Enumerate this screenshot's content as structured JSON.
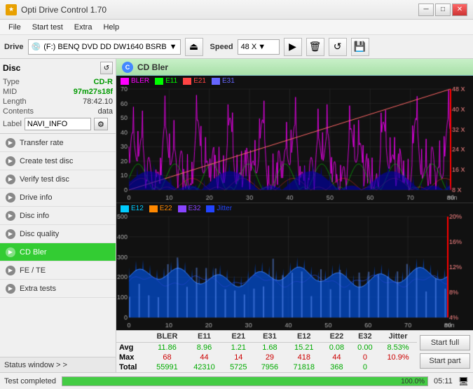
{
  "titlebar": {
    "title": "Opti Drive Control 1.70",
    "icon": "★",
    "minimize": "─",
    "maximize": "□",
    "close": "✕"
  },
  "menu": {
    "items": [
      "File",
      "Start test",
      "Extra",
      "Help"
    ]
  },
  "drive": {
    "label": "Drive",
    "drive_name": "(F:)  BENQ DVD DD DW1640 BSRB",
    "speed_label": "Speed",
    "speed_value": "48 X",
    "drive_icon": "💿"
  },
  "disc": {
    "title": "Disc",
    "type_key": "Type",
    "type_val": "CD-R",
    "mid_key": "MID",
    "mid_val": "97m27s18f",
    "length_key": "Length",
    "length_val": "78:42.10",
    "contents_key": "Contents",
    "contents_val": "data",
    "label_key": "Label",
    "label_val": "NAVI_INFO"
  },
  "nav": {
    "items": [
      {
        "id": "transfer-rate",
        "label": "Transfer rate",
        "active": false
      },
      {
        "id": "create-test-disc",
        "label": "Create test disc",
        "active": false
      },
      {
        "id": "verify-test-disc",
        "label": "Verify test disc",
        "active": false
      },
      {
        "id": "drive-info",
        "label": "Drive info",
        "active": false
      },
      {
        "id": "disc-info",
        "label": "Disc info",
        "active": false
      },
      {
        "id": "disc-quality",
        "label": "Disc quality",
        "active": false
      },
      {
        "id": "cd-bler",
        "label": "CD Bler",
        "active": true
      },
      {
        "id": "fe-te",
        "label": "FE / TE",
        "active": false
      },
      {
        "id": "extra-tests",
        "label": "Extra tests",
        "active": false
      }
    ],
    "status_window": "Status window > >"
  },
  "chart": {
    "title": "CD Bler",
    "icon": "C",
    "legend1": [
      {
        "label": "BLER",
        "color": "#ff00ff"
      },
      {
        "label": "E11",
        "color": "#00ff00"
      },
      {
        "label": "E21",
        "color": "#ff4444"
      },
      {
        "label": "E31",
        "color": "#4444ff"
      }
    ],
    "legend2": [
      {
        "label": "E12",
        "color": "#00ccff"
      },
      {
        "label": "E22",
        "color": "#ff8800"
      },
      {
        "label": "E32",
        "color": "#8844ff"
      },
      {
        "label": "Jitter",
        "color": "#2244ff"
      }
    ]
  },
  "stats": {
    "headers": [
      "",
      "BLER",
      "E11",
      "E21",
      "E31",
      "E12",
      "E22",
      "E32",
      "Jitter"
    ],
    "rows": [
      {
        "label": "Avg",
        "values": [
          "11.86",
          "8.96",
          "1.21",
          "1.68",
          "15.21",
          "0.08",
          "0.00",
          "8.53%"
        ],
        "color": "green"
      },
      {
        "label": "Max",
        "values": [
          "68",
          "44",
          "29",
          "418",
          "44",
          "0",
          "10.9%"
        ],
        "color": "red"
      },
      {
        "label": "Total",
        "values": [
          "55991",
          "42310",
          "5725",
          "7956",
          "71818",
          "368",
          "0",
          ""
        ],
        "color": "green"
      }
    ],
    "max_values": [
      "68",
      "44",
      "14",
      "29",
      "418",
      "44",
      "0",
      "10.9%"
    ],
    "total_values": [
      "55991",
      "42310",
      "5725",
      "7956",
      "71818",
      "368",
      "0",
      ""
    ],
    "btn_start_full": "Start full",
    "btn_start_part": "Start part"
  },
  "statusbar": {
    "text": "Test completed",
    "progress": 100,
    "progress_pct": "100.0%",
    "time": "05:11"
  }
}
